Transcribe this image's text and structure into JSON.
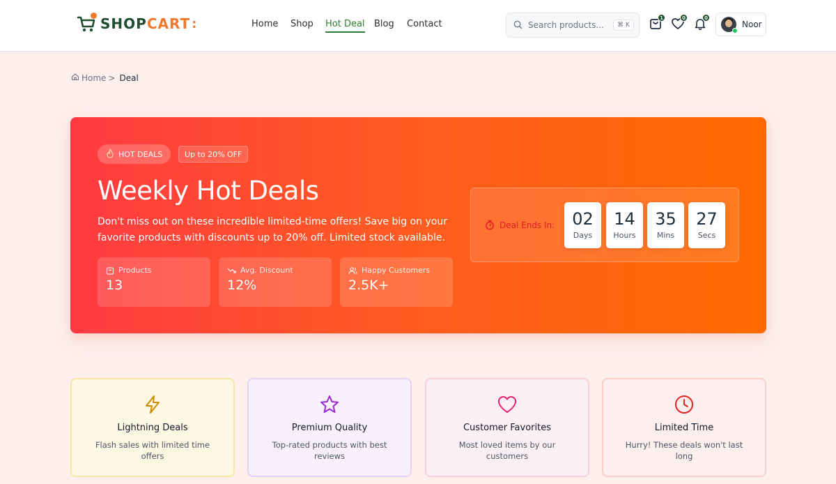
{
  "logo": {
    "part1": "SHOP",
    "part2": "CART",
    "colon": ":"
  },
  "nav": [
    {
      "label": "Home",
      "active": false
    },
    {
      "label": "Shop",
      "active": false
    },
    {
      "label": "Hot Deal",
      "active": true
    },
    {
      "label": "Blog",
      "active": false
    },
    {
      "label": "Contact",
      "active": false
    }
  ],
  "search": {
    "placeholder": "Search products...",
    "shortcut": "⌘ K"
  },
  "header_icons": {
    "cart_count": "1",
    "wishlist_count": "0",
    "notifications_count": "0"
  },
  "user": {
    "name": "Noor"
  },
  "breadcrumb": {
    "home": "Home",
    "separator": ">",
    "current": "Deal"
  },
  "hero": {
    "badge": "HOT DEALS",
    "discount_badge": "Up to 20% OFF",
    "title": "Weekly Hot Deals",
    "description": "Don't miss out on these incredible limited-time offers! Save big on your favorite products with discounts up to 20% off. Limited stock available.",
    "stats": [
      {
        "label": "Products",
        "value": "13",
        "icon": "bag-icon"
      },
      {
        "label": "Avg. Discount",
        "value": "12%",
        "icon": "trending-down-icon"
      },
      {
        "label": "Happy Customers",
        "value": "2.5K+",
        "icon": "users-icon"
      }
    ],
    "countdown": {
      "label": "Deal Ends In:",
      "units": [
        {
          "value": "02",
          "label": "Days"
        },
        {
          "value": "14",
          "label": "Hours"
        },
        {
          "value": "35",
          "label": "Mins"
        },
        {
          "value": "27",
          "label": "Secs"
        }
      ]
    }
  },
  "features": [
    {
      "title": "Lightning Deals",
      "description": "Flash sales with limited time offers",
      "icon": "lightning-icon",
      "color": "#d08a00"
    },
    {
      "title": "Premium Quality",
      "description": "Top-rated products with best reviews",
      "icon": "star-icon",
      "color": "#9b27d8"
    },
    {
      "title": "Customer Favorites",
      "description": "Most loved items by our customers",
      "icon": "heart-icon",
      "color": "#e0266f"
    },
    {
      "title": "Limited Time",
      "description": "Hurry! These deals won't last long",
      "icon": "clock-icon",
      "color": "#e0261f"
    }
  ],
  "colors": {
    "brand_green": "#1f4d2f",
    "brand_orange": "#f07a2c",
    "hero_start": "#ff3a41",
    "hero_end": "#ff6a00",
    "page_bg": "#fcefec"
  }
}
